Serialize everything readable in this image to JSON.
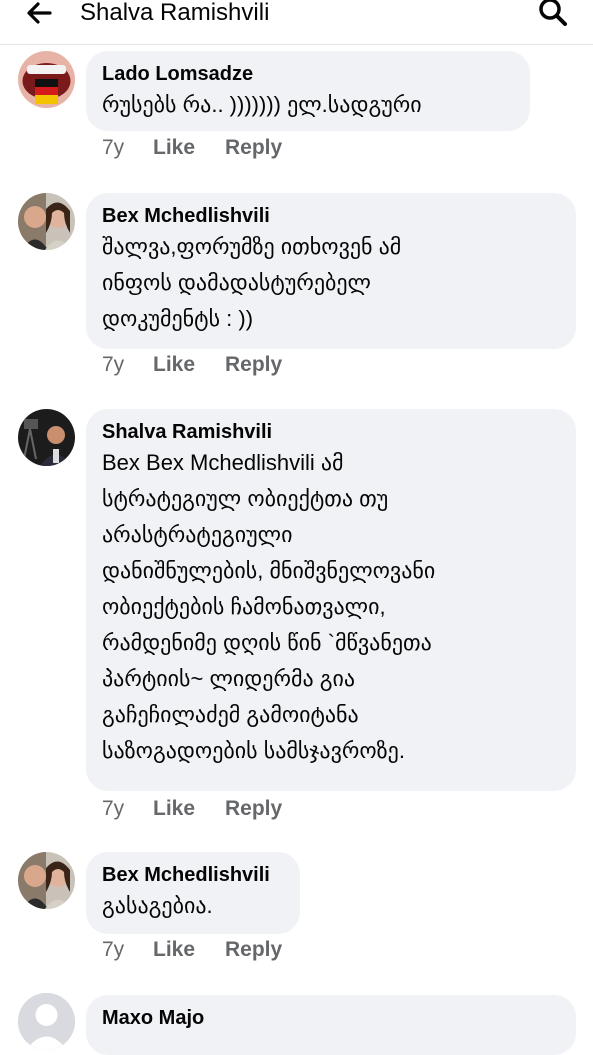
{
  "header": {
    "title": "Shalva Ramishvili"
  },
  "comments": [
    {
      "author": "Lado Lomsadze",
      "text": "რუსებს რა.. ))))))) ელ.სადგური",
      "time": "7y",
      "like": "Like",
      "reply": "Reply"
    },
    {
      "author": "Bex Mchedlishvili",
      "text": "შალვა,ფორუმზე ითხოვენ ამ\nინფოს დამადასტურებელ\nდოკუმენტს : ))",
      "time": "7y",
      "like": "Like",
      "reply": "Reply"
    },
    {
      "author": "Shalva Ramishvili",
      "text": "Bex Bex Mchedlishvili ამ\nსტრატეგიულ ობიექტთა თუ\nარასტრატეგიული\nდანიშნულების, მნიშვნელოვანი\nობიექტების ჩამონათვალი,\nრამდენიმე დღის წინ `მწვანეთა\nპარტიის~ ლიდერმა გია\nგაჩეჩილაძემ გამოიტანა\nსაზოგადოების სამსჯავროზე.",
      "time": "7y",
      "like": "Like",
      "reply": "Reply"
    },
    {
      "author": "Bex Mchedlishvili",
      "text": "გასაგებია.",
      "time": "7y",
      "like": "Like",
      "reply": "Reply"
    },
    {
      "author": "Maxo Majo"
    }
  ]
}
